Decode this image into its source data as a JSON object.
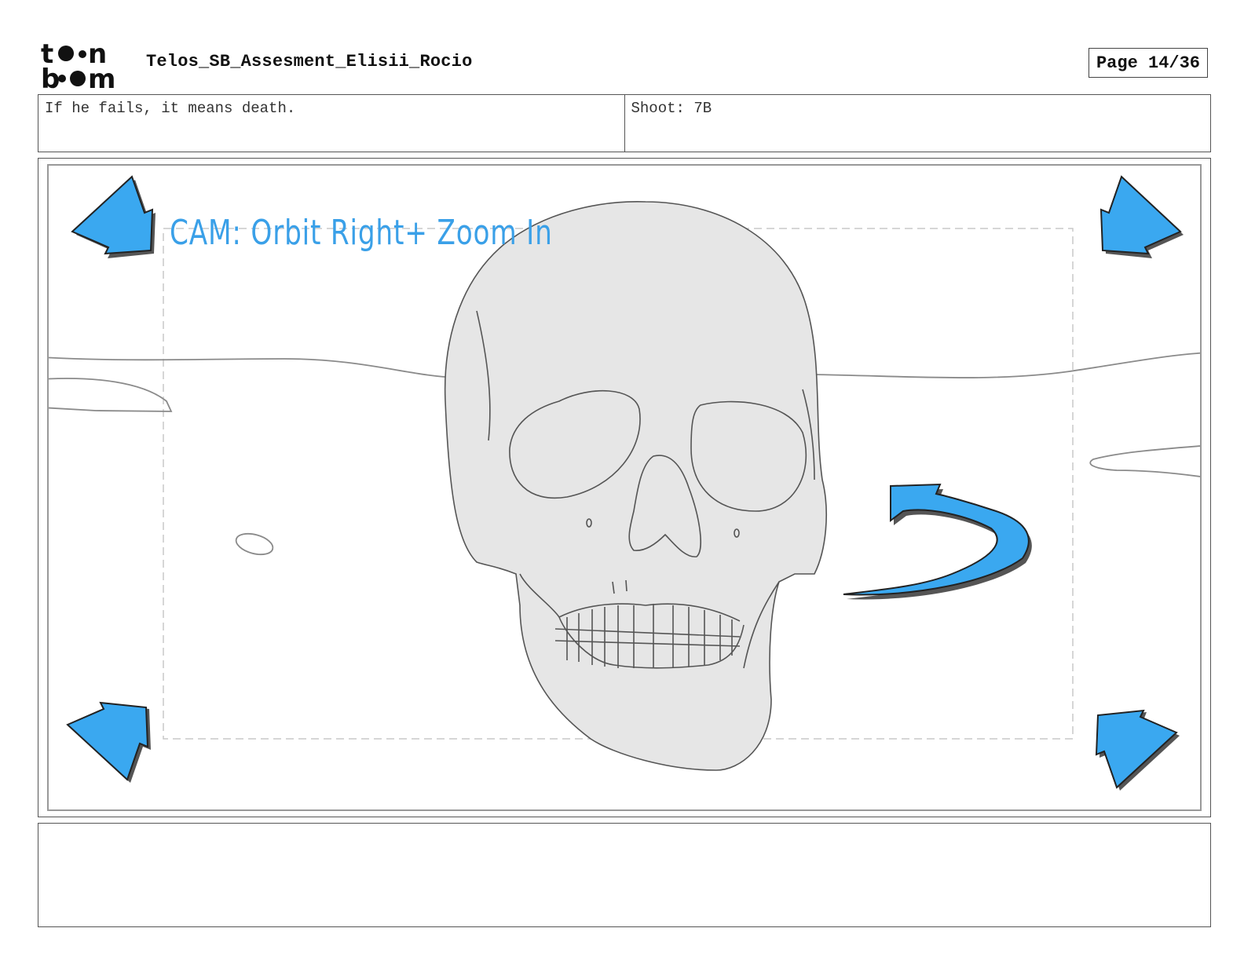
{
  "header": {
    "logo_text": "toon boom",
    "document_title": "Telos_SB_Assesment_Elisii_Rocio",
    "page_indicator": "Page 14/36"
  },
  "panel": {
    "dialogue": "If he fails, it means death.",
    "shot": "Shoot: 7B",
    "camera_note": "CAM: Orbit Right+ Zoom In",
    "notes": ""
  },
  "colors": {
    "arrow_blue": "#3aa8f0",
    "arrow_shadow": "#555555",
    "skull_fill": "#e6e6e6",
    "cam_text": "#3aa0e8"
  }
}
